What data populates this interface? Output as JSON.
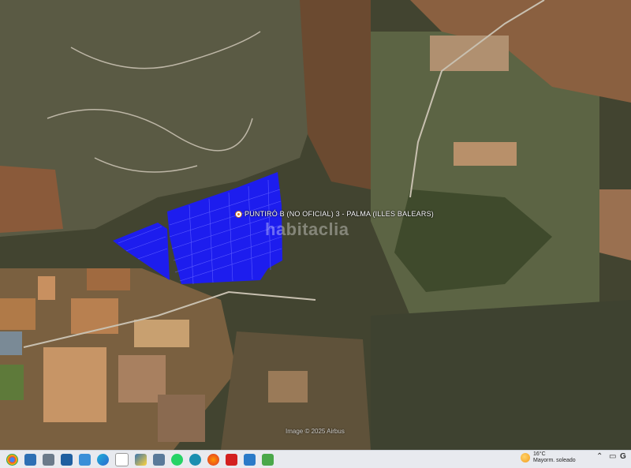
{
  "map": {
    "place_label": "PUNTIRÓ B (NO OFICIAL) 3 - PALMA (ILLES BALEARS)",
    "watermark": "habitaclia",
    "imagery_credit": "Image © 2025 Airbus",
    "parcel_color": "#1a1aff"
  },
  "taskbar": {
    "icons": [
      "chrome-icon",
      "task-manager-icon",
      "file-explorer-icon",
      "remote-desktop-icon",
      "photos-icon",
      "edge-icon",
      "notepad-icon",
      "python-icon",
      "store-icon",
      "whatsapp-icon",
      "browser-icon",
      "firefox-icon",
      "acrobat-icon",
      "sync-icon",
      "media-icon"
    ],
    "weather": {
      "temperature": "16°C",
      "condition": "Mayorm. soleado"
    },
    "tray_text": "G"
  }
}
